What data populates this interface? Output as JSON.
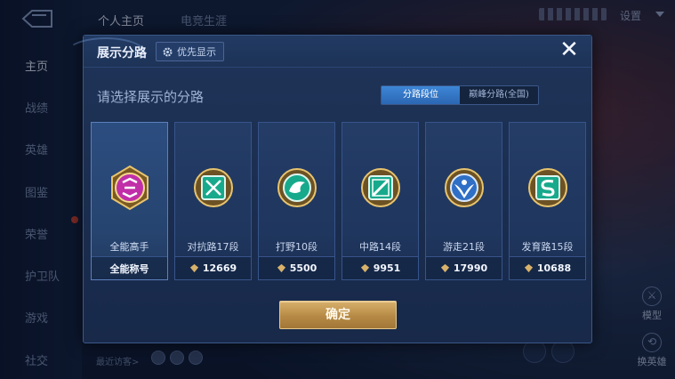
{
  "background": {
    "nav_items": [
      "主页",
      "战绩",
      "英雄",
      "图鉴",
      "荣誉",
      "护卫队",
      "游戏",
      "社交"
    ],
    "top_tabs": [
      "个人主页",
      "电竞生涯"
    ],
    "settings_label": "设置",
    "right_buttons": [
      "模型",
      "换英雄"
    ],
    "visitors_label": "最近访客>"
  },
  "dialog": {
    "title": "展示分路",
    "priority_label": "优先显示",
    "close_symbol": "✕",
    "subtitle": "请选择展示的分路",
    "toggle": {
      "options": [
        "分路段位",
        "巅峰分路(全国)"
      ],
      "selected": "分路段位"
    },
    "cards": [
      {
        "label": "全能高手",
        "footer": "全能称号",
        "badge_color": "#c02fa8",
        "badge_icon": "all-rounder-icon",
        "selected": true
      },
      {
        "label": "对抗路17段",
        "footer": "12669",
        "badge_color": "#17a98c",
        "badge_icon": "clash-lane-icon"
      },
      {
        "label": "打野10段",
        "footer": "5500",
        "badge_color": "#17a98c",
        "badge_icon": "jungle-icon"
      },
      {
        "label": "中路14段",
        "footer": "9951",
        "badge_color": "#17a98c",
        "badge_icon": "mid-lane-icon"
      },
      {
        "label": "游走21段",
        "footer": "17990",
        "badge_color": "#2f6fc6",
        "badge_icon": "roam-icon"
      },
      {
        "label": "发育路15段",
        "footer": "10688",
        "badge_color": "#17a98c",
        "badge_icon": "farm-lane-icon"
      }
    ],
    "confirm_label": "确定"
  }
}
